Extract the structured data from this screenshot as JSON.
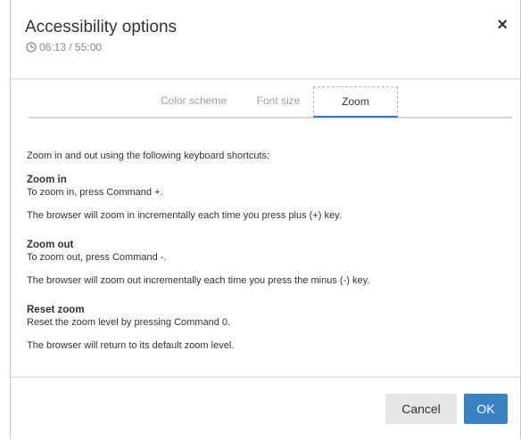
{
  "dialog": {
    "title": "Accessibility options",
    "timer": "06:13 / 55:00",
    "close_label": "×"
  },
  "tabs": [
    {
      "label": "Color scheme",
      "active": false
    },
    {
      "label": "Font size",
      "active": false
    },
    {
      "label": "Zoom",
      "active": true
    }
  ],
  "content": {
    "intro": "Zoom in and out using the following keyboard shortcuts:",
    "sections": [
      {
        "heading": "Zoom in",
        "line1": "To zoom in, press Command +.",
        "line2": "The browser will zoom in incrementally each time you press plus (+) key."
      },
      {
        "heading": "Zoom out",
        "line1": "To zoom out, press Command -.",
        "line2": "The browser will zoom out incrementally each time you press the minus (-) key."
      },
      {
        "heading": "Reset zoom",
        "line1": "Reset the zoom level by pressing Command 0.",
        "line2": "The browser will return to its default zoom level."
      }
    ]
  },
  "footer": {
    "cancel_label": "Cancel",
    "ok_label": "OK"
  },
  "colors": {
    "accent": "#3b82c4",
    "tab_underline": "#3377c5",
    "text": "#333333",
    "muted": "#8a8a8a"
  },
  "icons": {
    "timer": "clock-icon",
    "close": "close-icon"
  }
}
